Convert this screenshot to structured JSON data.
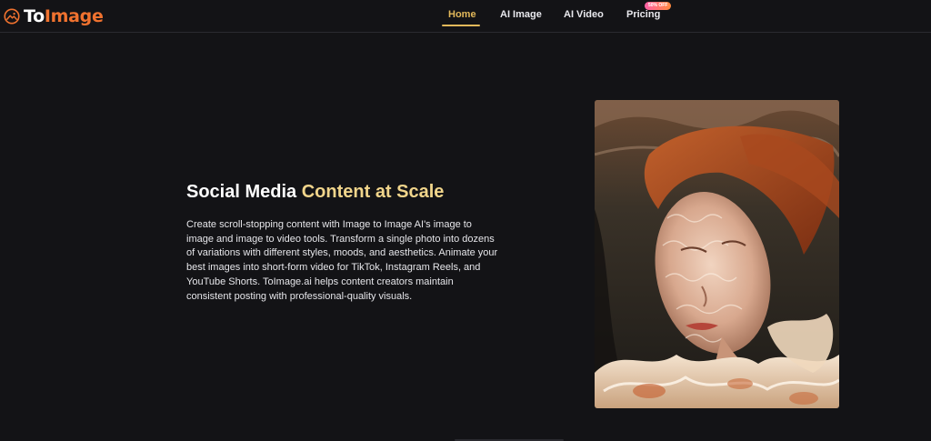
{
  "brand": {
    "name_part1": "To",
    "name_part2": "Image",
    "logo_icon": "image-landscape-icon",
    "accent_color": "#f0722f"
  },
  "nav": {
    "items": [
      {
        "label": "Home",
        "active": true
      },
      {
        "label": "AI Image",
        "active": false
      },
      {
        "label": "AI Video",
        "active": false
      },
      {
        "label": "Pricing",
        "active": false
      }
    ],
    "pricing_badge": "50% OFF",
    "active_color": "#e2b85a"
  },
  "hero": {
    "headline_part1": "Social Media ",
    "headline_part2": "Content at Scale",
    "headline_accent_color": "#f1d58b",
    "body": "Create scroll-stopping content with Image to Image AI's image to image and image to video tools. Transform a single photo into dozens of variations with different styles, moods, and aesthetics. Animate your best images into short-form video for TikTok, Instagram Reels, and YouTube Shorts. ToImage.ai helps content creators maintain consistent posting with professional-quality visuals."
  }
}
